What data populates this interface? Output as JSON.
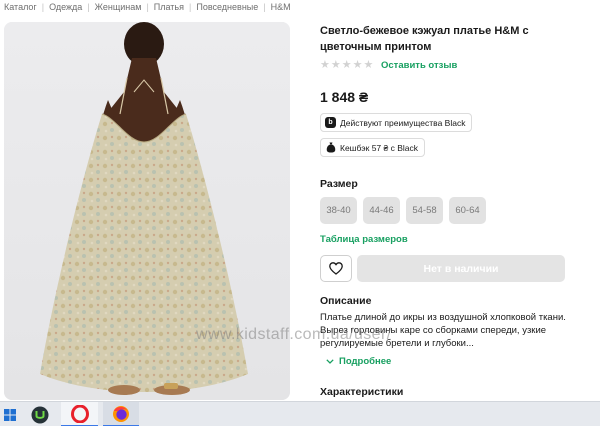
{
  "breadcrumb": {
    "items": [
      "Каталог",
      "Одежда",
      "Женщинам",
      "Платья",
      "Повседневные",
      "H&M"
    ],
    "separator": "|"
  },
  "product": {
    "title": "Светло-бежевое кэжуал платье H&M с цветочным принтом",
    "rating_stars": 0,
    "stars": [
      "★",
      "★",
      "★",
      "★",
      "★"
    ],
    "review_link": "Оставить отзыв",
    "price": "1 848 ₴",
    "badges": {
      "black": {
        "icon": "b",
        "label": "Действуют преимущества Black"
      },
      "cashback": {
        "icon": "money-bag-icon",
        "label": "Кешбэк 57 ₴ с Black"
      }
    }
  },
  "sizes": {
    "label": "Размер",
    "options": [
      "38-40",
      "44-46",
      "54-58",
      "60-64"
    ],
    "table_link": "Таблица размеров"
  },
  "actions": {
    "favorite_icon": "heart-icon",
    "stock_label": "Нет в наличии"
  },
  "description": {
    "label": "Описание",
    "text": "Платье длиной до икры из воздушной хлопковой ткани. Вырез горловины каре со сборками спереди, узкие регулируемые бретели и глубоки...",
    "more_link": "Подробнее"
  },
  "characteristics": {
    "label": "Характеристики"
  },
  "watermark": "www.kidstaff.com.ua/user/",
  "taskbar": {
    "apps": [
      "windows-start-icon",
      "upwork-icon",
      "opera-icon",
      "firefox-icon"
    ]
  },
  "colors": {
    "accent_green": "#18a061",
    "disabled_gray": "#e4e4e4",
    "dress_beige": "#d5cdb0",
    "skin": "#4a2b1c"
  }
}
